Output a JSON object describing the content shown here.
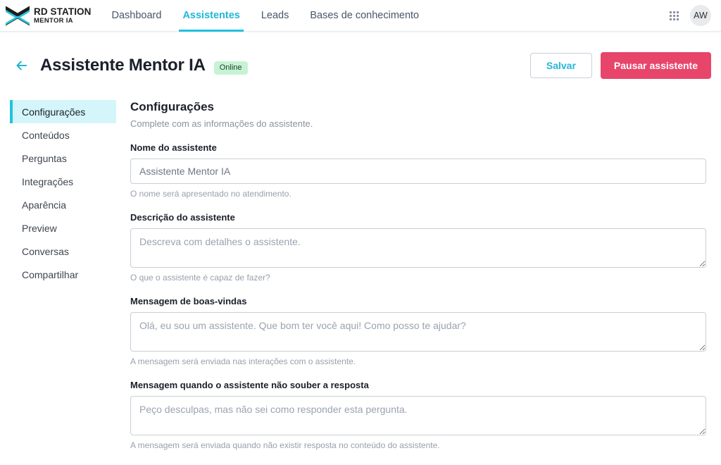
{
  "brand": {
    "line1": "RD STATION",
    "line2": "MENTOR IA",
    "logo_icon": "rd-chevrons-logo",
    "accent": "#21c3de",
    "dark": "#1d1d1b"
  },
  "topnav": {
    "links": [
      {
        "label": "Dashboard",
        "active": false
      },
      {
        "label": "Assistentes",
        "active": true
      },
      {
        "label": "Leads",
        "active": false
      },
      {
        "label": "Bases de conhecimento",
        "active": false
      }
    ],
    "apps_icon": "app-grid-icon",
    "avatar_initials": "AW"
  },
  "pagehead": {
    "back_icon": "arrow-left-icon",
    "title": "Assistente Mentor IA",
    "status": "Online",
    "status_bg": "#c6f3d3",
    "save_label": "Salvar",
    "pause_label": "Pausar assistente",
    "pause_bg": "#e8456b"
  },
  "sidebar": {
    "items": [
      {
        "label": "Configurações",
        "active": true
      },
      {
        "label": "Conteúdos",
        "active": false
      },
      {
        "label": "Perguntas",
        "active": false
      },
      {
        "label": "Integrações",
        "active": false
      },
      {
        "label": "Aparência",
        "active": false
      },
      {
        "label": "Preview",
        "active": false
      },
      {
        "label": "Conversas",
        "active": false
      },
      {
        "label": "Compartilhar",
        "active": false
      }
    ]
  },
  "main": {
    "heading": "Configurações",
    "subheading": "Complete com as informações do assistente.",
    "fields": [
      {
        "label": "Nome do assistente",
        "type": "input",
        "value": "Assistente Mentor IA",
        "placeholder": "",
        "hint": "O nome será apresentado no atendimento."
      },
      {
        "label": "Descrição do assistente",
        "type": "textarea",
        "value": "",
        "placeholder": "Descreva com detalhes o assistente.",
        "hint": "O que o assistente é capaz de fazer?"
      },
      {
        "label": "Mensagem de boas-vindas",
        "type": "textarea",
        "value": "",
        "placeholder": "Olá, eu sou um assistente. Que bom ter você aqui! Como posso te ajudar?",
        "hint": "A mensagem será enviada nas interações com o assistente."
      },
      {
        "label": "Mensagem quando o assistente não souber a resposta",
        "type": "textarea",
        "value": "",
        "placeholder": "Peço desculpas, mas não sei como responder esta pergunta.",
        "hint": "A mensagem será enviada quando não existir resposta no conteúdo do assistente."
      }
    ]
  }
}
